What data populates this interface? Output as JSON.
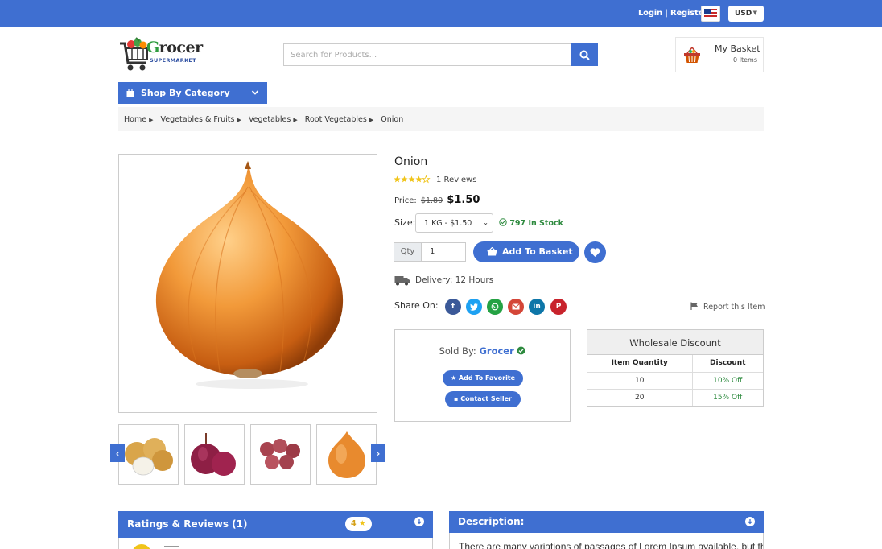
{
  "topbar": {
    "login_register": "Login | Register",
    "currency": "USD"
  },
  "logo": {
    "name_part1": "G",
    "name_part2": "rocer",
    "subtitle": "SUPERMARKET"
  },
  "search": {
    "placeholder": "Search for Products..."
  },
  "basket": {
    "title": "My Basket",
    "count": "0 Items"
  },
  "shop_category": {
    "label": "Shop By Category"
  },
  "breadcrumb": [
    "Home",
    "Vegetables & Fruits",
    "Vegetables",
    "Root Vegetables",
    "Onion"
  ],
  "product": {
    "name": "Onion",
    "rating": 4,
    "reviews": "1 Reviews",
    "price_label": "Price:",
    "old_price": "$1.80",
    "new_price": "$1.50",
    "size_label": "Size:",
    "size_selected": "1 KG - $1.50",
    "stock": "797 In Stock",
    "qty_label": "Qty",
    "qty_value": "1",
    "add_to_basket": "Add To Basket",
    "delivery": "Delivery: 12 Hours",
    "share_label": "Share On:",
    "report": "Report this Item"
  },
  "seller": {
    "sold_by": "Sold By:",
    "name": "Grocer",
    "add_favorite": "Add To Favorite",
    "contact": "Contact Seller"
  },
  "wholesale": {
    "title": "Wholesale Discount",
    "headers": [
      "Item Quantity",
      "Discount"
    ],
    "rows": [
      {
        "qty": "10",
        "discount": "10% Off"
      },
      {
        "qty": "20",
        "discount": "15% Off"
      }
    ]
  },
  "reviews_panel": {
    "title": "Ratings & Reviews (1)",
    "badge": "4"
  },
  "description_panel": {
    "title": "Description:",
    "text": "There are many variations of passages of Lorem Ipsum available, but the"
  },
  "colors": {
    "primary": "#3f6fd1",
    "success": "#2d8a3e",
    "star": "#f0c419"
  }
}
